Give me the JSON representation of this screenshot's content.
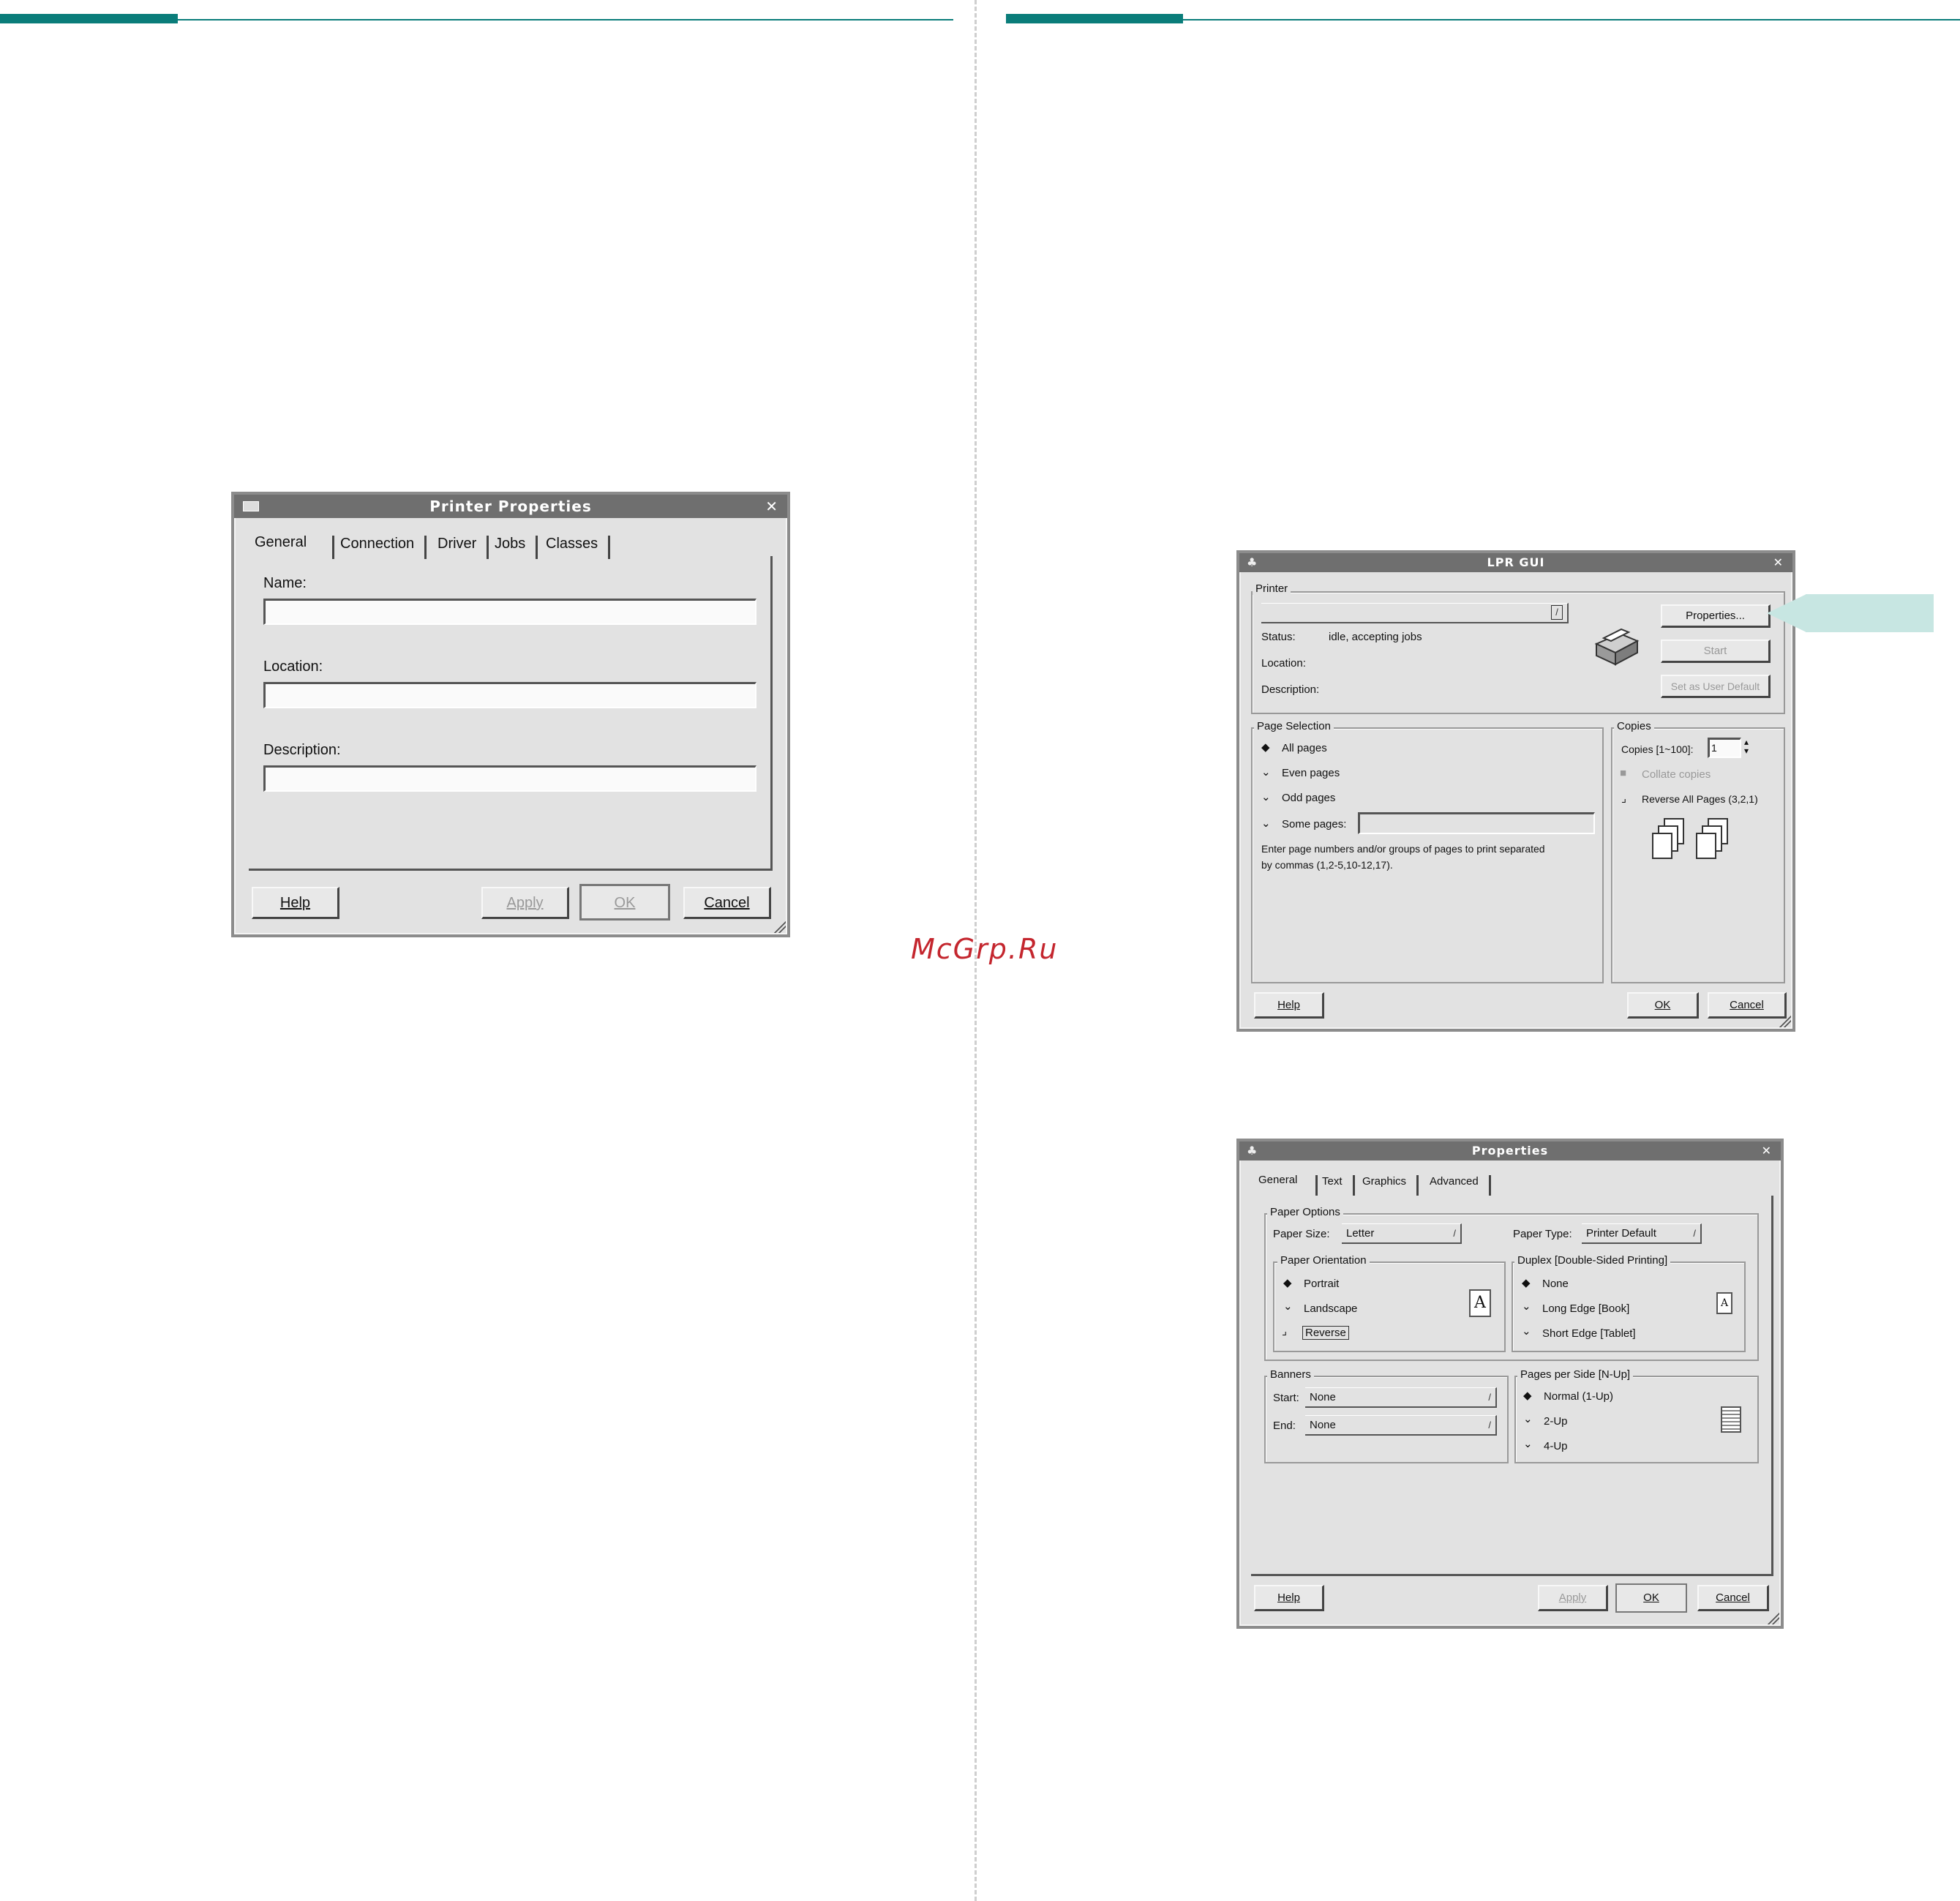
{
  "watermark": "McGrp.Ru",
  "printer_properties": {
    "title": "Printer Properties",
    "close": "✕",
    "tabs": [
      "General",
      "Connection",
      "Driver",
      "Jobs",
      "Classes"
    ],
    "name_label": "Name:",
    "location_label": "Location:",
    "description_label": "Description:",
    "buttons": {
      "help": "Help",
      "apply": "Apply",
      "ok": "OK",
      "cancel": "Cancel"
    }
  },
  "lpr_gui": {
    "title": "LPR GUI",
    "close": "✕",
    "printer_group": "Printer",
    "status_label": "Status:",
    "status_value": "idle, accepting jobs",
    "location_label": "Location:",
    "description_label": "Description:",
    "properties_button": "Properties...",
    "start_button": "Start",
    "set_default_button": "Set as User Default",
    "page_selection_group": "Page Selection",
    "all_pages": "All pages",
    "even_pages": "Even pages",
    "odd_pages": "Odd pages",
    "some_pages": "Some pages:",
    "hint_line1": "Enter page numbers and/or groups of pages to print separated",
    "hint_line2": "by commas (1,2-5,10-12,17).",
    "copies_group": "Copies",
    "copies_label": "Copies [1~100]:",
    "copies_value": "1",
    "collate": "Collate copies",
    "reverse": "Reverse All Pages (3,2,1)",
    "buttons": {
      "help": "Help",
      "ok": "OK",
      "cancel": "Cancel"
    }
  },
  "properties": {
    "title": "Properties",
    "close": "✕",
    "tabs": [
      "General",
      "Text",
      "Graphics",
      "Advanced"
    ],
    "paper_options_group": "Paper Options",
    "paper_size_label": "Paper Size:",
    "paper_size_value": "Letter",
    "paper_type_label": "Paper Type:",
    "paper_type_value": "Printer Default",
    "orientation_group": "Paper Orientation",
    "portrait": "Portrait",
    "landscape": "Landscape",
    "reverse": "Reverse",
    "duplex_group": "Duplex [Double-Sided Printing]",
    "none": "None",
    "long_edge": "Long Edge [Book]",
    "short_edge": "Short Edge [Tablet]",
    "banners_group": "Banners",
    "start_label": "Start:",
    "start_value": "None",
    "end_label": "End:",
    "end_value": "None",
    "nup_group": "Pages per Side [N-Up]",
    "normal": "Normal (1-Up)",
    "two_up": "2-Up",
    "four_up": "4-Up",
    "icon_letter": "A",
    "buttons": {
      "help": "Help",
      "apply": "Apply",
      "ok": "OK",
      "cancel": "Cancel"
    }
  },
  "colors": {
    "accent": "#0a7d7a",
    "watermark": "#c4262e",
    "callout": "#c7e6e2"
  },
  "icons": [
    "window-menu-icon",
    "close-icon",
    "printer-icon",
    "portrait-page-icon",
    "collate-pages-icon",
    "combo-arrow-icon",
    "spin-arrow-icon"
  ]
}
